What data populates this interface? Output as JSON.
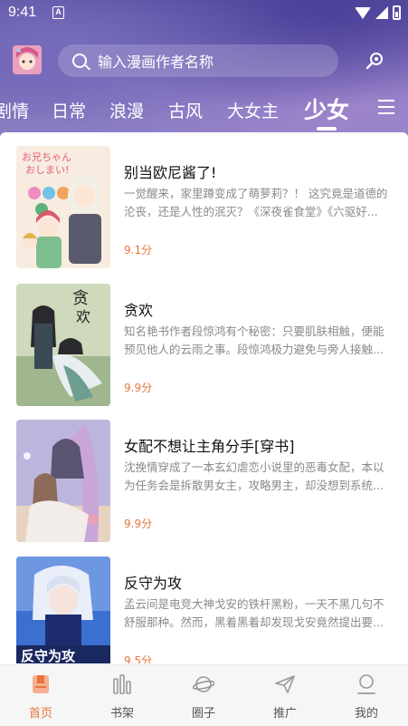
{
  "status_bar": {
    "time": "9:41",
    "notification": "A"
  },
  "search": {
    "placeholder": "输入漫画作者名称"
  },
  "tabs": [
    {
      "label": "剧情"
    },
    {
      "label": "日常"
    },
    {
      "label": "浪漫"
    },
    {
      "label": "古风"
    },
    {
      "label": "大女主"
    },
    {
      "label": "少女",
      "active": true
    }
  ],
  "menu_icon": "menu-icon",
  "comics": [
    {
      "title": "别当欧尼酱了!",
      "description": "一觉醒来，家里蹲变成了萌萝莉？！ 这究竟是道德的沦丧，还是人性的泯灭？《深夜雀食堂》《六驱好...",
      "score": "9.1分",
      "cover_colors": [
        "#f4e6d6",
        "#e85d7a",
        "#7aa86d"
      ]
    },
    {
      "title": "贪欢",
      "description": "知名艳书作者段惊鸿有个秘密：只要肌肤相触，便能预见他人的云雨之事。段惊鸿极力避免与旁人接触...",
      "score": "9.9分",
      "cover_colors": [
        "#cfd8b8",
        "#3c4a3a",
        "#7fa080"
      ]
    },
    {
      "title": "女配不想让主角分手[穿书]",
      "description": "沈挽情穿成了一本玄幻虐恋小说里的恶毒女配，本以为任务会是拆散男女主，攻略男主，却没想到系统...",
      "score": "9.9分",
      "cover_colors": [
        "#b9b3d8",
        "#e8c7a6",
        "#6e6aa0"
      ]
    },
    {
      "title": "反守为攻",
      "description": "孟云间是电竞大神戈安的铁杆黑粉，一天不黑几句不舒服那种。然而，黑着黑着却发现戈安竟然提出要...",
      "score": "9.5分",
      "cover_colors": [
        "#3b6fd0",
        "#9fb8e8",
        "#1d2c6a"
      ]
    }
  ],
  "bottom_nav": [
    {
      "label": "首页",
      "icon": "home-icon",
      "active": true
    },
    {
      "label": "书架",
      "icon": "bookshelf-icon"
    },
    {
      "label": "圈子",
      "icon": "planet-icon"
    },
    {
      "label": "推广",
      "icon": "paper-plane-icon"
    },
    {
      "label": "我的",
      "icon": "profile-icon"
    }
  ],
  "colors": {
    "accent": "#e8743b",
    "header_gradient": "#6c5fb0"
  }
}
